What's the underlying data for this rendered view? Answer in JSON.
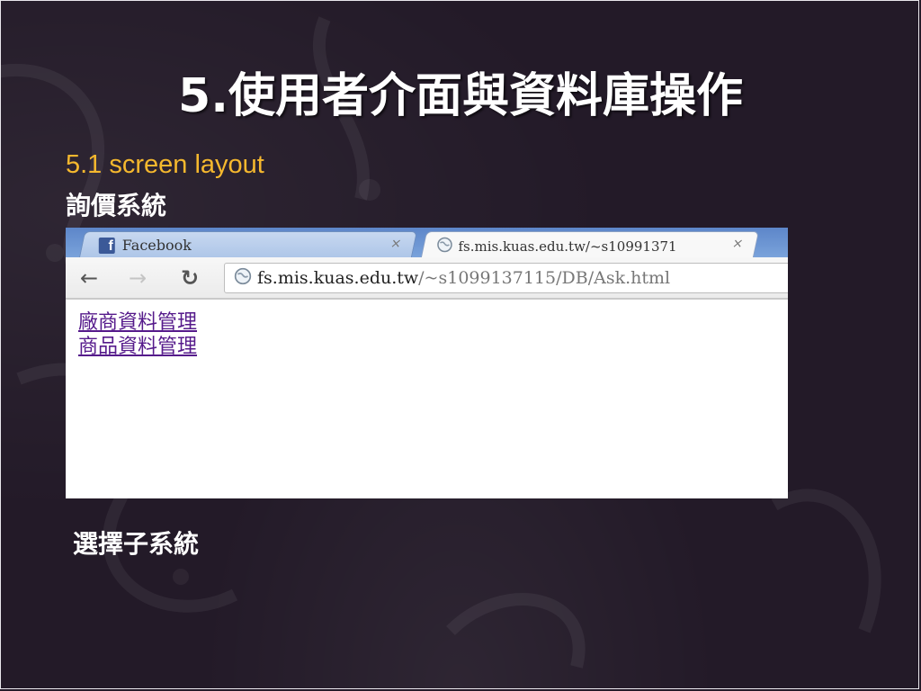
{
  "slide": {
    "title": "5.使用者介面與資料庫操作",
    "subtitle": "5.1 screen layout",
    "section_label_1": "詢價系統",
    "section_label_2": "選擇子系統"
  },
  "browser": {
    "tabs": [
      {
        "label": "Facebook",
        "icon": "facebook-icon",
        "active": false
      },
      {
        "label": "fs.mis.kuas.edu.tw/~s10991371",
        "icon": "globe-icon",
        "active": true
      }
    ],
    "close_glyph": "×",
    "address": {
      "host": "fs.mis.kuas.edu.tw",
      "path": "/~s1099137115/DB/Ask.html"
    },
    "links": [
      {
        "label": "廠商資料管理"
      },
      {
        "label": "商品資料管理"
      }
    ]
  },
  "colors": {
    "background": "#231a28",
    "subtitle": "#f5b82e",
    "link_visited": "#551a8b"
  }
}
